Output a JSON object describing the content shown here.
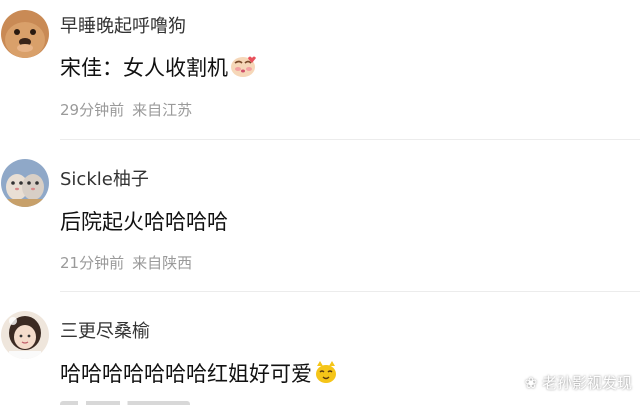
{
  "comments": [
    {
      "username": "早睡晚起呼噜狗",
      "text": "宋佳：女人收割机",
      "emoji": "kiss-face-emoji",
      "time": "29分钟前",
      "location": "来自江苏"
    },
    {
      "username": "Sickle柚子",
      "text": "后院起火哈哈哈哈",
      "time": "21分钟前",
      "location": "来自陕西"
    },
    {
      "username": "三更尽桑榆",
      "text": "哈哈哈哈哈哈哈红姐好可爱",
      "emoji": "cat-face-emoji"
    }
  ],
  "watermark": "老孙影视发现",
  "colors": {
    "username": "#333333",
    "content": "#111111",
    "meta": "#9a9a9a",
    "divider": "#ececec"
  }
}
